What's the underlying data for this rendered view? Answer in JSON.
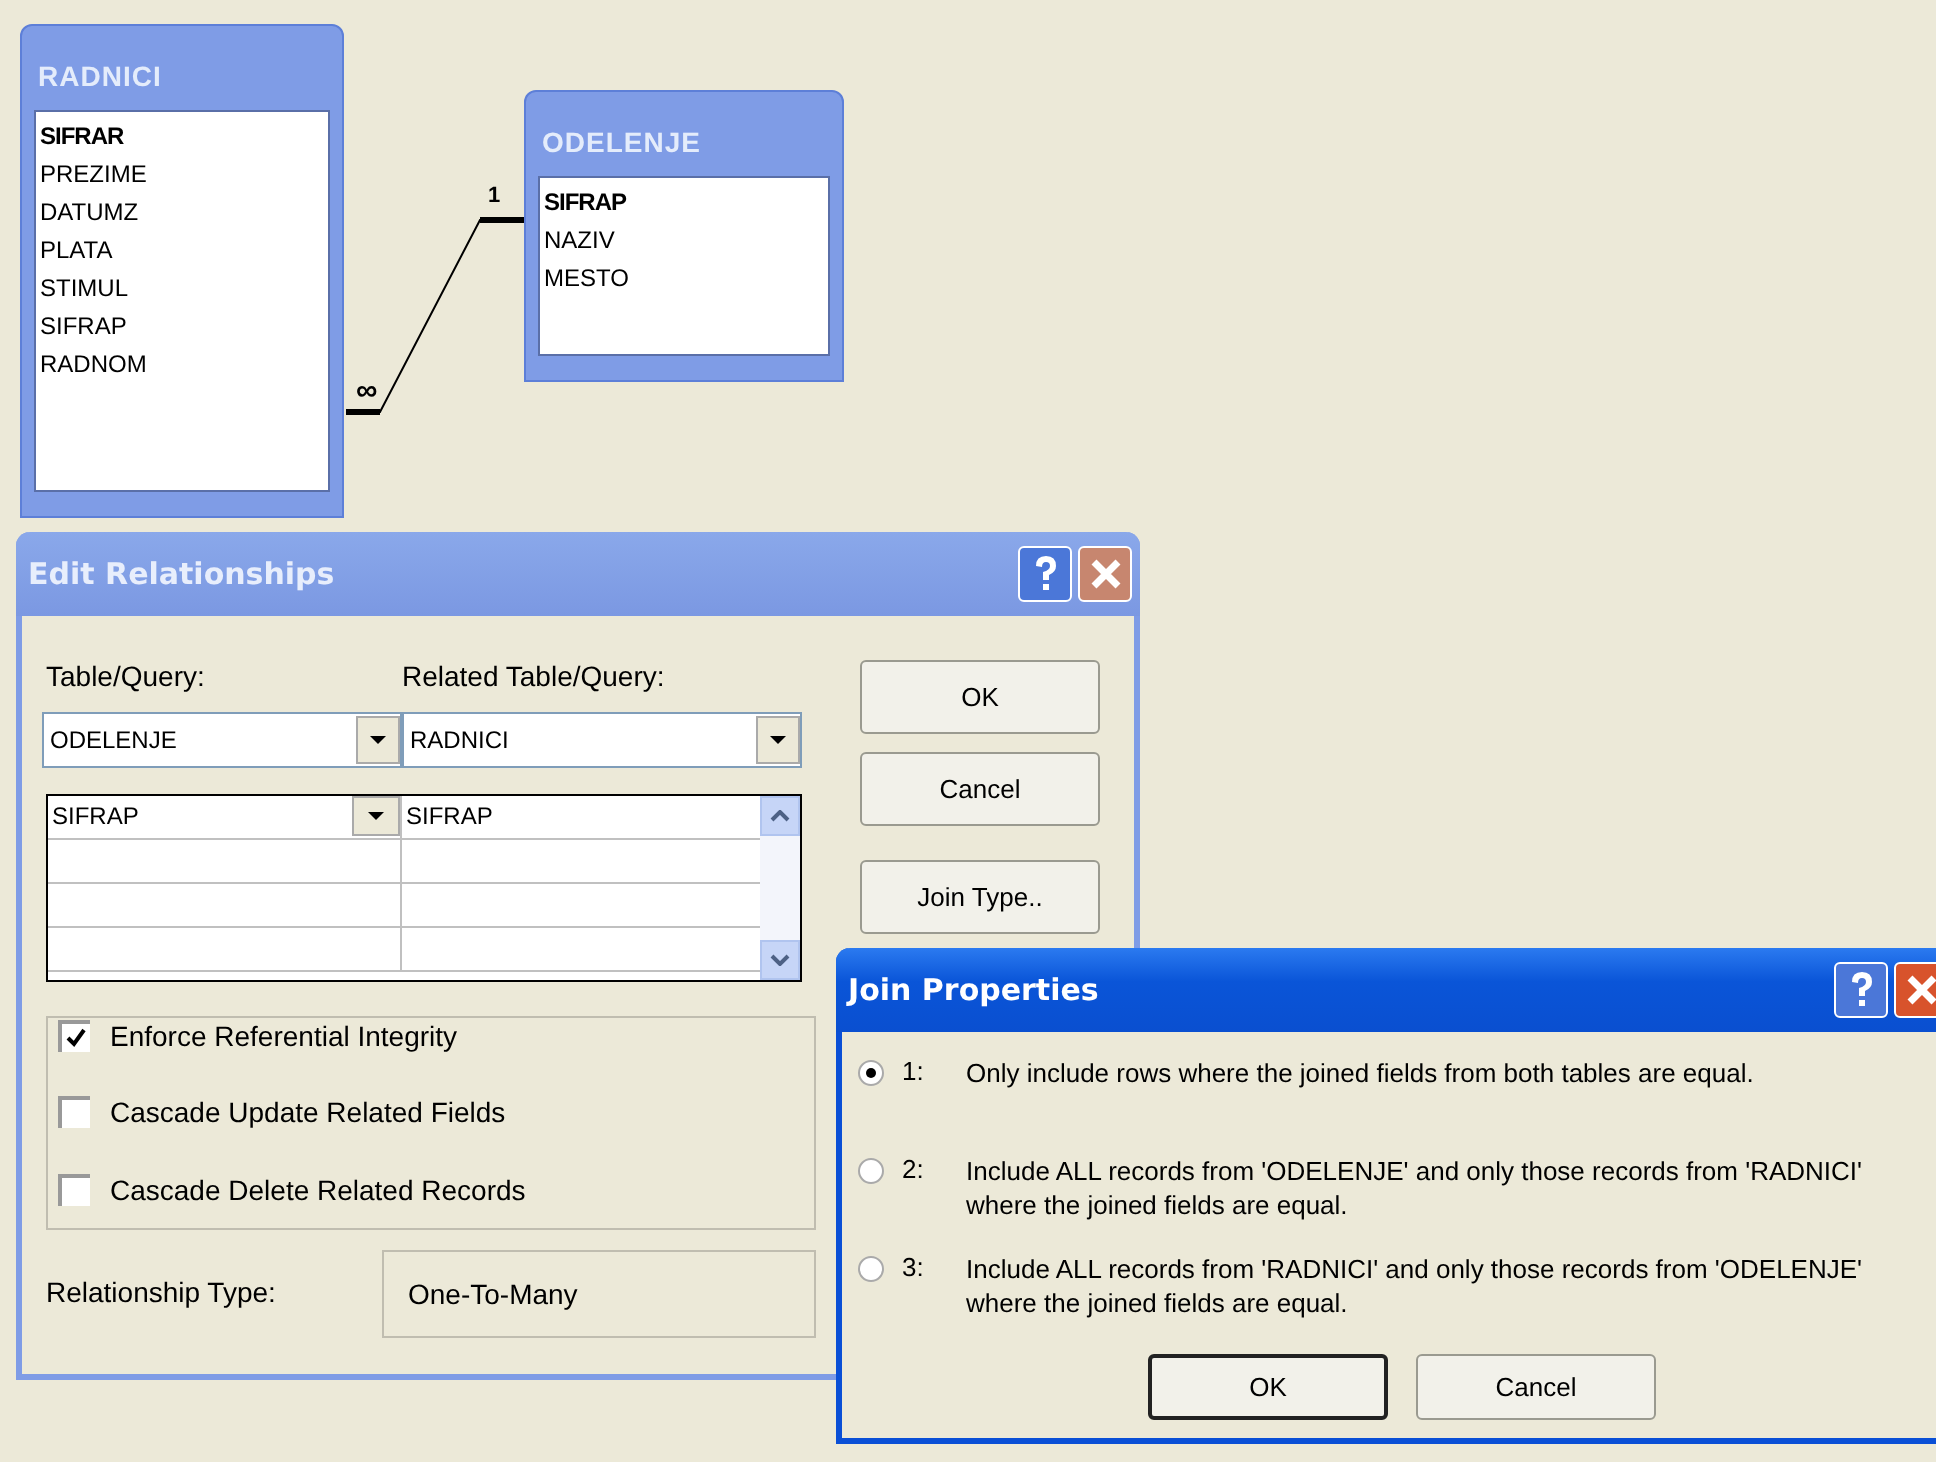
{
  "tables": [
    {
      "title": "RADNICI",
      "fields": [
        {
          "name": "SIFRAR",
          "key": true
        },
        {
          "name": "PREZIME",
          "key": false
        },
        {
          "name": "DATUMZ",
          "key": false
        },
        {
          "name": "PLATA",
          "key": false
        },
        {
          "name": "STIMUL",
          "key": false
        },
        {
          "name": "SIFRAP",
          "key": false
        },
        {
          "name": "RADNOM",
          "key": false
        }
      ]
    },
    {
      "title": "ODELENJE",
      "fields": [
        {
          "name": "SIFRAP",
          "key": true
        },
        {
          "name": "NAZIV",
          "key": false
        },
        {
          "name": "MESTO",
          "key": false
        }
      ]
    }
  ],
  "relationship": {
    "one_label": "1",
    "many_label": "∞"
  },
  "edit_dialog": {
    "title": "Edit Relationships",
    "active": false,
    "table_label": "Table/Query:",
    "related_label": "Related Table/Query:",
    "table_value": "ODELENJE",
    "related_value": "RADNICI",
    "field_rows": [
      {
        "left": "SIFRAP",
        "right": "SIFRAP"
      }
    ],
    "checkboxes": [
      {
        "label": "Enforce Referential Integrity",
        "checked": true
      },
      {
        "label": "Cascade Update Related Fields",
        "checked": false
      },
      {
        "label": "Cascade Delete Related Records",
        "checked": false
      }
    ],
    "relationship_type_label": "Relationship Type:",
    "relationship_type": "One-To-Many",
    "buttons": [
      "OK",
      "Cancel",
      "Join Type.."
    ]
  },
  "join_dialog": {
    "title": "Join Properties",
    "active": true,
    "options": [
      {
        "number": "1:",
        "text": "Only include rows where the joined fields from both tables are equal.",
        "selected": true
      },
      {
        "number": "2:",
        "text": "Include ALL records from 'ODELENJE' and only those records from 'RADNICI' where the joined fields are equal.",
        "selected": false
      },
      {
        "number": "3:",
        "text": "Include ALL records from 'RADNICI' and only those records from 'ODELENJE' where the joined fields are equal.",
        "selected": false
      }
    ],
    "buttons": [
      "OK",
      "Cancel"
    ]
  }
}
